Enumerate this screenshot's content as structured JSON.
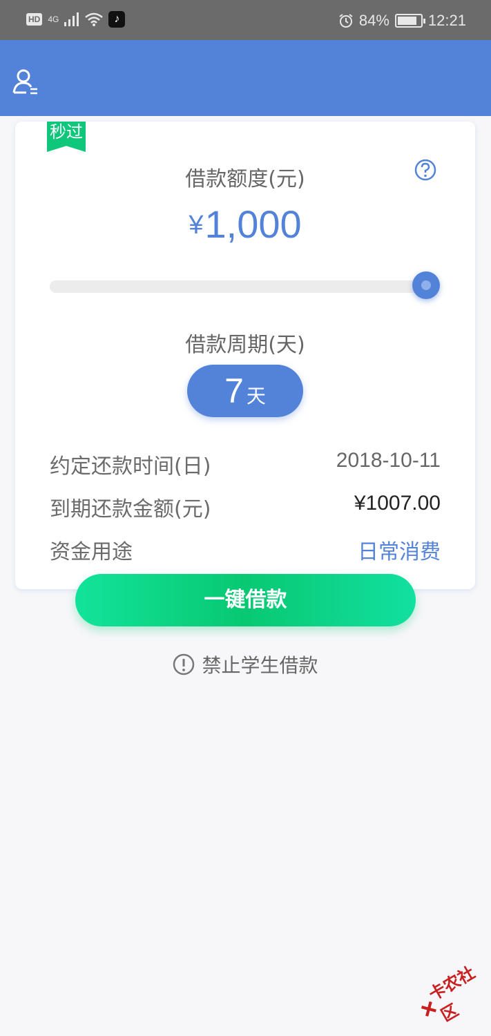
{
  "status_bar": {
    "network": "4G",
    "battery": "84%",
    "time": "12:21",
    "battery_level": 0.84
  },
  "header": {
    "user_icon": "user-menu-icon"
  },
  "card": {
    "badge": "秒过",
    "amount_label": "借款额度(元)",
    "amount_currency": "¥",
    "amount_value": "1,000",
    "slider_level": 1.0,
    "period_label": "借款周期(天)",
    "period_value": "7",
    "period_unit": "天",
    "rows": [
      {
        "label": "约定还款时间(日)",
        "value": "2018-10-11"
      },
      {
        "label": "到期还款金额(元)",
        "value": "¥1007.00"
      },
      {
        "label": "资金用途",
        "value": "日常消费"
      }
    ]
  },
  "cta": {
    "label": "一键借款"
  },
  "notice": {
    "text": "禁止学生借款"
  },
  "watermark": {
    "text": "卡农社区"
  },
  "colors": {
    "primary": "#5383d9",
    "green": "#0fc77b",
    "status_bar": "#6b6b6b"
  }
}
